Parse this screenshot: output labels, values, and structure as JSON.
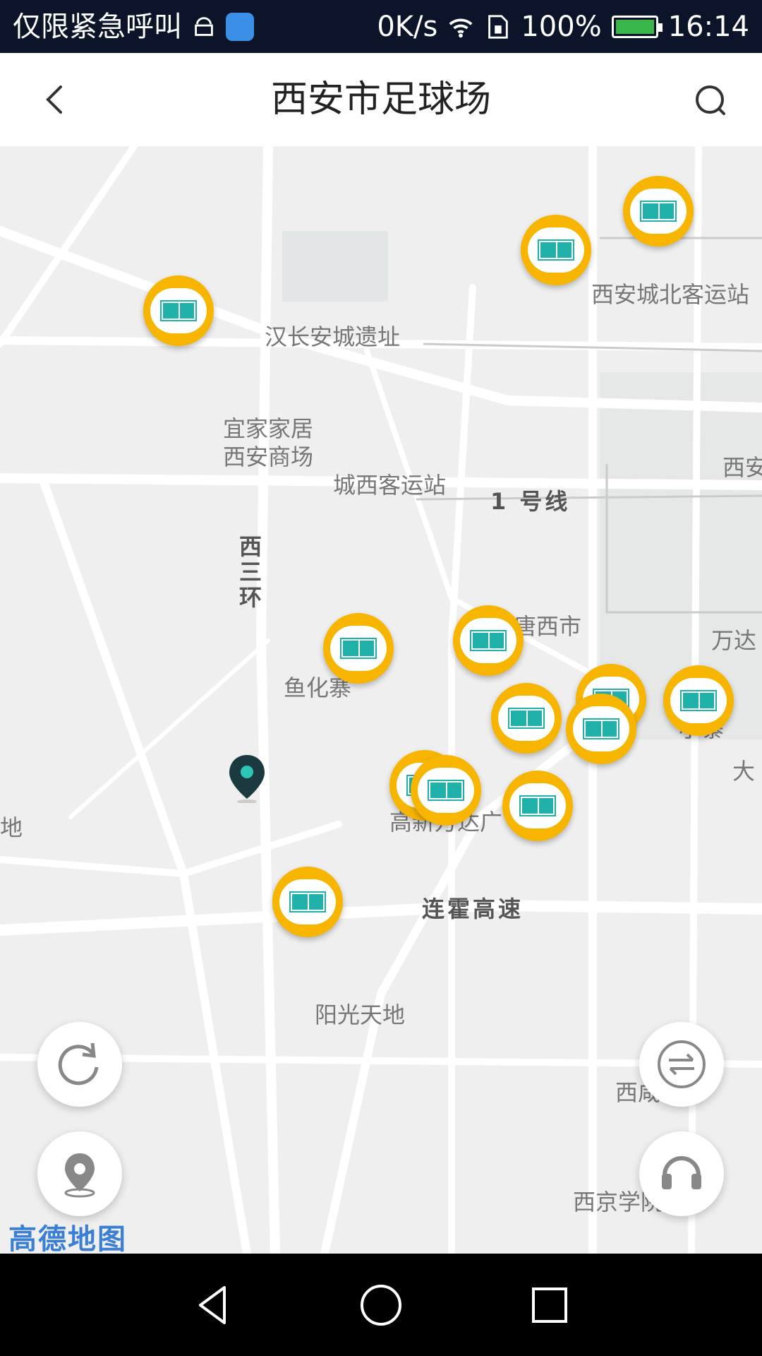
{
  "status_bar": {
    "carrier": "仅限紧急呼叫",
    "net_speed": "0K/s",
    "battery": "100%",
    "time": "16:14"
  },
  "header": {
    "title": "西安市足球场",
    "back_icon": "chevron-left-icon",
    "search_icon": "search-icon"
  },
  "map": {
    "labels": {
      "beike": "西安城北客运站",
      "hanchang": "汉长安城遗址",
      "yijia1": "宜家家居",
      "yijia2": "西安商场",
      "chengxi": "城西客运站",
      "line1": "1 号线",
      "xian_edge": "西安",
      "xisanhuan": "西三环",
      "tangxi": "唐西市",
      "wanda": "万达",
      "yuhua": "鱼化寨",
      "xiaozhai": "小寨",
      "da": "大",
      "gaoxin": "高新万达广",
      "lianhuo": "连霍高速",
      "yangguang": "阳光天地",
      "xixian": "西咸",
      "xijing": "西京学院",
      "edge_left": "地"
    },
    "marker_count": 14,
    "marker_icon": "football-field-icon",
    "location_pin_color": "#1a3a3f",
    "accent": "#f7b500"
  },
  "controls": {
    "refresh_icon": "refresh-icon",
    "locate_icon": "location-icon",
    "switch_icon": "switch-icon",
    "service_icon": "headset-icon"
  },
  "logo": "高德地图",
  "system_nav": {
    "back_icon": "triangle-back-icon",
    "home_icon": "circle-home-icon",
    "recent_icon": "square-recent-icon"
  }
}
